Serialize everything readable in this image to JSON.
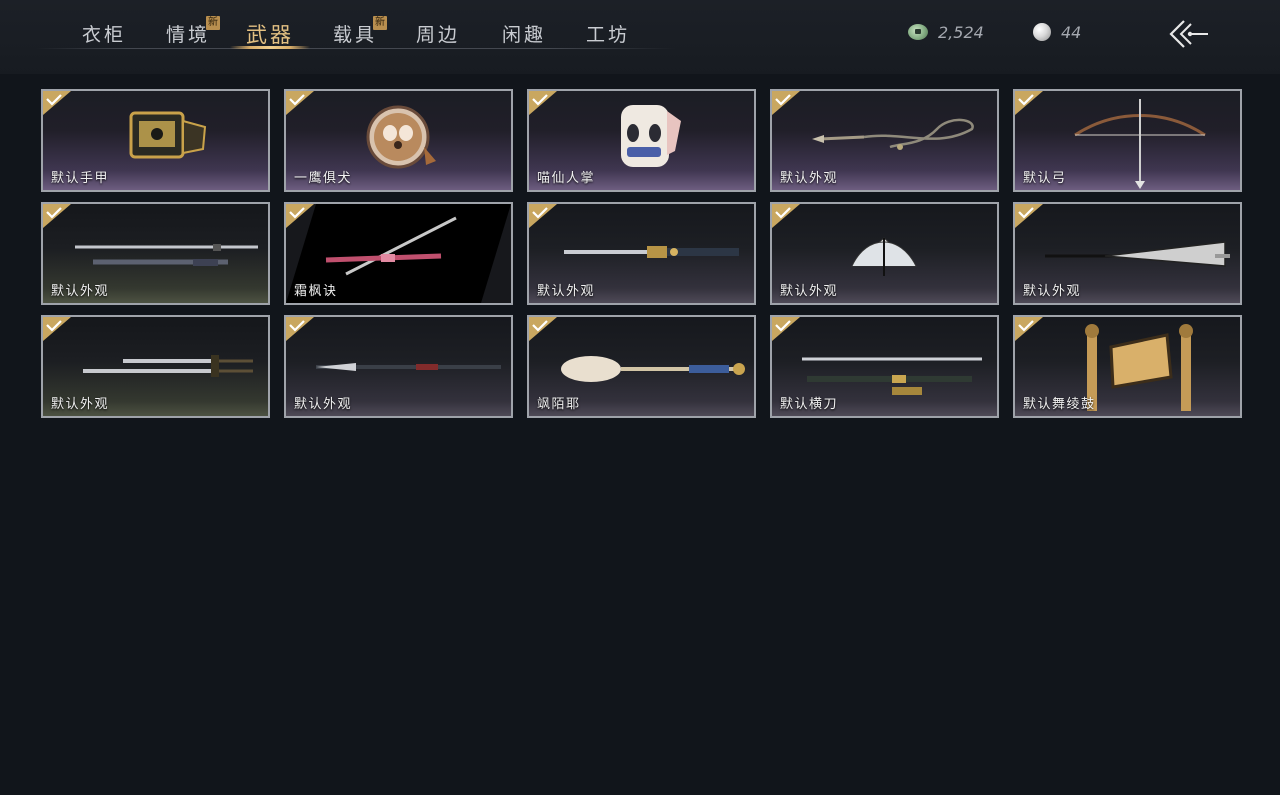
{
  "nav": {
    "tabs": [
      {
        "label": "衣柜",
        "new": false,
        "active": false
      },
      {
        "label": "情境",
        "new": true,
        "active": false
      },
      {
        "label": "武器",
        "new": false,
        "active": true
      },
      {
        "label": "载具",
        "new": true,
        "active": false
      },
      {
        "label": "周边",
        "new": false,
        "active": false
      },
      {
        "label": "闲趣",
        "new": false,
        "active": false
      },
      {
        "label": "工坊",
        "new": false,
        "active": false
      }
    ],
    "new_badge": "新"
  },
  "currency": {
    "jade": "2,524",
    "pearl": "44"
  },
  "icons": {
    "jade": "jade-coin-icon",
    "pearl": "pearl-icon",
    "back": "back-arrow-icon",
    "owned": "checkmark-icon"
  },
  "colors": {
    "accent_gold": "#e3c082",
    "tab_text": "#c9ccd1",
    "card_border": "#9fa3aa",
    "background": "#11151b",
    "owned_badge": "#c9a760"
  },
  "items": [
    {
      "label": "默认手甲",
      "art": "gauntlet",
      "owned": true
    },
    {
      "label": "一鹰俱犬",
      "art": "dog-plate",
      "owned": true
    },
    {
      "label": "喵仙人掌",
      "art": "cat-paw",
      "owned": true
    },
    {
      "label": "默认外观",
      "art": "rope-dart",
      "owned": true
    },
    {
      "label": "默认弓",
      "art": "bow",
      "owned": true
    },
    {
      "label": "默认外观",
      "art": "twin-swords",
      "owned": true
    },
    {
      "label": "霜枫诀",
      "art": "pink-sword",
      "owned": true
    },
    {
      "label": "默认外观",
      "art": "ornate-blade",
      "owned": true
    },
    {
      "label": "默认外观",
      "art": "fan",
      "owned": true
    },
    {
      "label": "默认外观",
      "art": "umbrella",
      "owned": true
    },
    {
      "label": "默认外观",
      "art": "dual-sabres",
      "owned": true
    },
    {
      "label": "默认外观",
      "art": "spear",
      "owned": true
    },
    {
      "label": "飒陌耶",
      "art": "mace",
      "owned": true
    },
    {
      "label": "默认横刀",
      "art": "hengdao",
      "owned": true
    },
    {
      "label": "默认舞绫鼓",
      "art": "drum",
      "owned": true
    }
  ]
}
